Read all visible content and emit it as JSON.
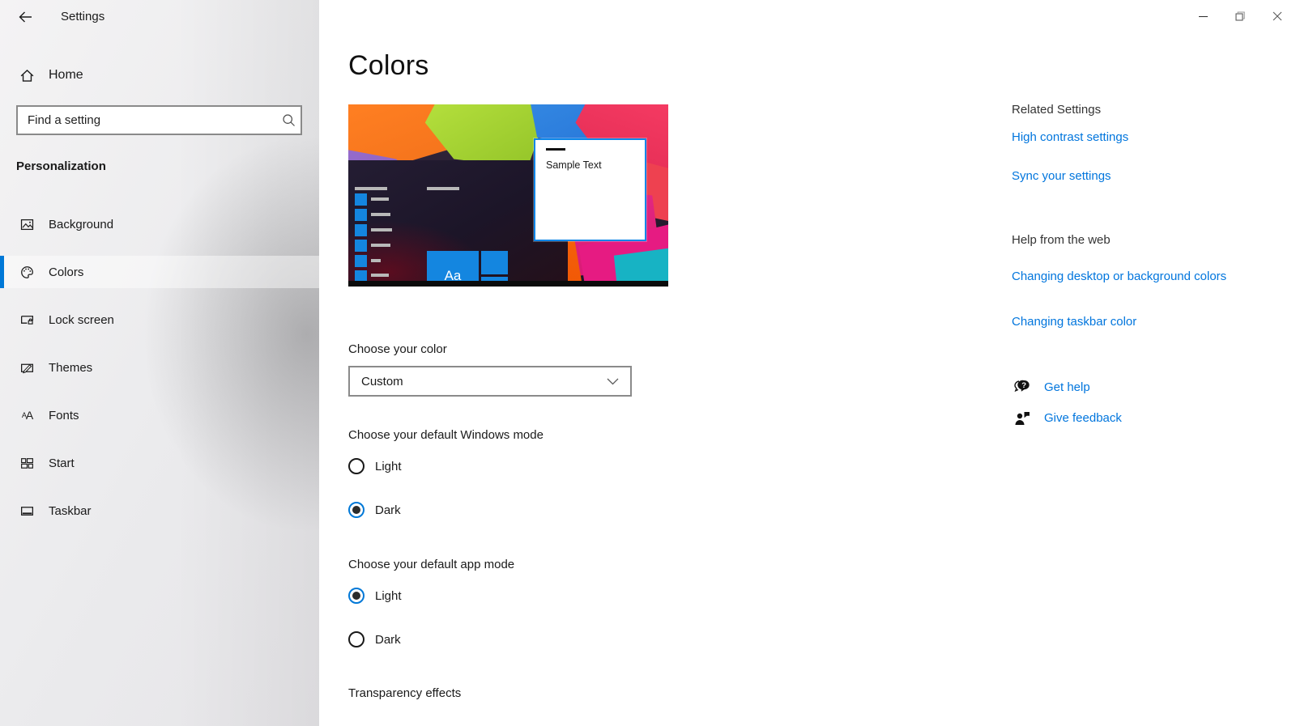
{
  "titlebar": {
    "app_title": "Settings"
  },
  "sidebar": {
    "home_label": "Home",
    "search_placeholder": "Find a setting",
    "section_label": "Personalization",
    "items": [
      {
        "label": "Background",
        "icon": "background-image-icon",
        "selected": false
      },
      {
        "label": "Colors",
        "icon": "colors-palette-icon",
        "selected": true
      },
      {
        "label": "Lock screen",
        "icon": "lock-screen-icon",
        "selected": false
      },
      {
        "label": "Themes",
        "icon": "themes-icon",
        "selected": false
      },
      {
        "label": "Fonts",
        "icon": "fonts-icon",
        "selected": false
      },
      {
        "label": "Start",
        "icon": "start-grid-icon",
        "selected": false
      },
      {
        "label": "Taskbar",
        "icon": "taskbar-icon",
        "selected": false
      }
    ]
  },
  "main": {
    "page_title": "Colors",
    "preview": {
      "start_tile_label": "Aa",
      "sample_window_text": "Sample Text"
    },
    "choose_color": {
      "label": "Choose your color",
      "value": "Custom"
    },
    "windows_mode": {
      "label": "Choose your default Windows mode",
      "options": [
        {
          "label": "Light",
          "selected": false
        },
        {
          "label": "Dark",
          "selected": true
        }
      ]
    },
    "app_mode": {
      "label": "Choose your default app mode",
      "options": [
        {
          "label": "Light",
          "selected": true
        },
        {
          "label": "Dark",
          "selected": false
        }
      ]
    },
    "transparency_label": "Transparency effects"
  },
  "related": {
    "title": "Related Settings",
    "links": [
      "High contrast settings",
      "Sync your settings"
    ]
  },
  "help_web": {
    "title": "Help from the web",
    "links": [
      "Changing desktop or background colors",
      "Changing taskbar color"
    ]
  },
  "support": [
    {
      "label": "Get help",
      "icon": "help-bubble-icon"
    },
    {
      "label": "Give feedback",
      "icon": "feedback-person-icon"
    }
  ],
  "colors": {
    "accent": "#0078d7",
    "link": "#0075dd",
    "tile_blue": "#1486e0",
    "sidebar_selected_bar": "#0078d7"
  }
}
